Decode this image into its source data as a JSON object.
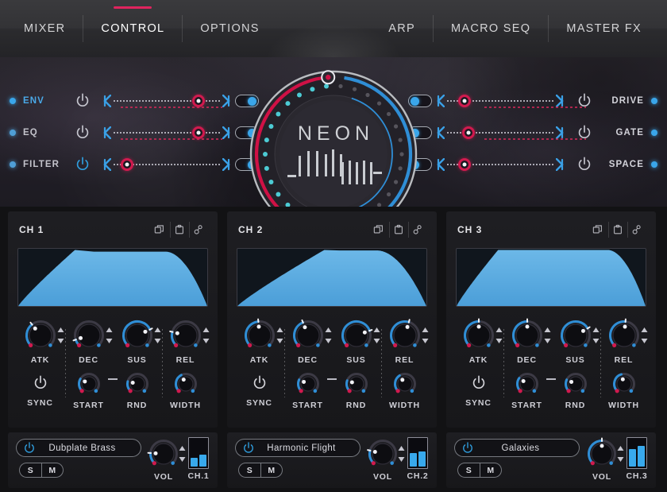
{
  "colors": {
    "accent_pink": "#e0245e",
    "accent_crimson": "#d01a4e",
    "accent_blue": "#3aa6ea",
    "accent_cyan": "#4fd5dd",
    "env_fill": "#55a8e0",
    "panel_bg": "#1b1b1f",
    "text_primary": "#e6e6ea",
    "text_dim": "#9a9aa3"
  },
  "navbar": {
    "left_tabs": [
      {
        "label": "MIXER",
        "active": false
      },
      {
        "label": "CONTROL",
        "active": true
      },
      {
        "label": "OPTIONS",
        "active": false
      }
    ],
    "right_tabs": [
      {
        "label": "ARP",
        "active": false
      },
      {
        "label": "MACRO SEQ",
        "active": false
      },
      {
        "label": "MASTER FX",
        "active": false
      }
    ]
  },
  "dial": {
    "logo_text": "NEON",
    "icon_name": "neon-dial",
    "red_arc_label": "macro-arc-red",
    "blue_arc_label": "macro-arc-blue"
  },
  "fx_left": [
    {
      "label": "ENV",
      "dot_color": "#3aa6ea",
      "label_color": "#4aa9e8",
      "power_on": false,
      "slider_value": 84,
      "toggle_on": true,
      "power_icon": "power-icon"
    },
    {
      "label": "EQ",
      "dot_color": "#4f9fd6",
      "label_color": "#c3c3cb",
      "power_on": false,
      "slider_value": 84,
      "toggle_on": true,
      "power_icon": "power-icon"
    },
    {
      "label": "FILTER",
      "dot_color": "#4f9fd6",
      "label_color": "#c3c3cb",
      "power_on": true,
      "slider_value": 8,
      "toggle_on": true,
      "power_icon": "power-icon"
    }
  ],
  "fx_right": [
    {
      "label": "DRIVE",
      "dot_color": "#3aa6ea",
      "label_color": "#d2d2d9",
      "power_on": false,
      "slider_value": 12,
      "toggle_on": false,
      "power_icon": "power-icon"
    },
    {
      "label": "GATE",
      "dot_color": "#3aa6ea",
      "label_color": "#d2d2d9",
      "power_on": false,
      "slider_value": 16,
      "toggle_on": false,
      "power_icon": "power-icon"
    },
    {
      "label": "SPACE",
      "dot_color": "#3aa6ea",
      "label_color": "#d2d2d9",
      "power_on": false,
      "slider_value": 12,
      "toggle_on": false,
      "power_icon": "power-icon"
    }
  ],
  "channels": [
    {
      "title": "CH 1",
      "icons": [
        "copy-icon",
        "paste-icon",
        "link-icon"
      ],
      "envelope": {
        "attack": 0.3,
        "decay": 0.1,
        "sustain": 0.95,
        "release": 0.22
      },
      "adsr": [
        {
          "label": "ATK",
          "value": 36
        },
        {
          "label": "DEC",
          "value": 10
        },
        {
          "label": "SUS",
          "value": 74
        },
        {
          "label": "REL",
          "value": 22
        }
      ],
      "row2": {
        "sync_label": "SYNC",
        "sync_on": false,
        "knobs": [
          {
            "label": "START",
            "value": 28
          },
          {
            "label": "RND",
            "value": 22
          },
          {
            "label": "WIDTH",
            "value": 40
          }
        ]
      },
      "preset": {
        "name": "Dubplate Brass",
        "power_on": true
      },
      "solo_label": "S",
      "mute_label": "M",
      "vol": {
        "label": "VOL",
        "value": 18
      },
      "meter": {
        "label": "CH.1",
        "bars": [
          30,
          42
        ]
      }
    },
    {
      "title": "CH 2",
      "icons": [
        "copy-icon",
        "paste-icon",
        "link-icon"
      ],
      "envelope": {
        "attack": 0.46,
        "decay": 0.08,
        "sustain": 0.97,
        "release": 0.26
      },
      "adsr": [
        {
          "label": "ATK",
          "value": 48
        },
        {
          "label": "DEC",
          "value": 42
        },
        {
          "label": "SUS",
          "value": 76
        },
        {
          "label": "REL",
          "value": 56
        }
      ],
      "row2": {
        "sync_label": "SYNC",
        "sync_on": false,
        "knobs": [
          {
            "label": "START",
            "value": 26
          },
          {
            "label": "RND",
            "value": 24
          },
          {
            "label": "WIDTH",
            "value": 38
          }
        ]
      },
      "preset": {
        "name": "Harmonic Flight",
        "power_on": true
      },
      "solo_label": "S",
      "mute_label": "M",
      "vol": {
        "label": "VOL",
        "value": 22
      },
      "meter": {
        "label": "CH.2",
        "bars": [
          48,
          52
        ]
      }
    },
    {
      "title": "CH 3",
      "icons": [
        "copy-icon",
        "paste-icon",
        "link-icon"
      ],
      "envelope": {
        "attack": 0.22,
        "decay": 0.06,
        "sustain": 0.98,
        "release": 0.2
      },
      "adsr": [
        {
          "label": "ATK",
          "value": 50
        },
        {
          "label": "DEC",
          "value": 50
        },
        {
          "label": "SUS",
          "value": 72
        },
        {
          "label": "REL",
          "value": 52
        }
      ],
      "row2": {
        "sync_label": "SYNC",
        "sync_on": false,
        "knobs": [
          {
            "label": "START",
            "value": 30
          },
          {
            "label": "RND",
            "value": 26
          },
          {
            "label": "WIDTH",
            "value": 44
          }
        ]
      },
      "preset": {
        "name": "Galaxies",
        "power_on": true
      },
      "solo_label": "S",
      "mute_label": "M",
      "vol": {
        "label": "VOL",
        "value": 50
      },
      "meter": {
        "label": "CH.3",
        "bars": [
          62,
          72
        ]
      }
    }
  ]
}
